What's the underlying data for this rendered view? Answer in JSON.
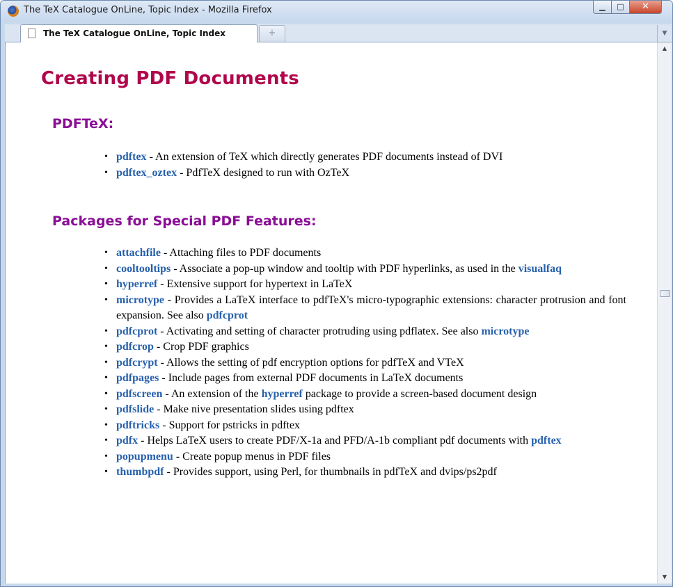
{
  "window": {
    "title": "The TeX Catalogue OnLine, Topic Index - Mozilla Firefox"
  },
  "tabs": [
    {
      "label": "The TeX Catalogue OnLine, Topic Index"
    }
  ],
  "newtab_label": "+",
  "page": {
    "title": "Creating PDF Documents",
    "sections": [
      {
        "heading": "PDFTeX:",
        "items": [
          {
            "name": "pdftex",
            "text": " - An extension of TeX which directly generates PDF documents instead of DVI"
          },
          {
            "name": "pdftex_oztex",
            "text": " - PdfTeX designed to run with OzTeX"
          }
        ]
      },
      {
        "heading": "Packages for Special PDF Features:",
        "items": [
          {
            "name": "attachfile",
            "text": " - Attaching files to PDF documents"
          },
          {
            "name": "cooltooltips",
            "text": " - Associate a pop-up window and tooltip with PDF hyperlinks, as used in the ",
            "link2": "visualfaq"
          },
          {
            "name": "hyperref",
            "text": " - Extensive support for hypertext in LaTeX"
          },
          {
            "name": "microtype",
            "text": " - Provides a LaTeX interface to pdfTeX's micro-typographic extensions: character protrusion and font expansion. See also ",
            "link2": "pdfcprot"
          },
          {
            "name": "pdfcprot",
            "text": " - Activating and setting of character protruding using pdflatex. See also ",
            "link2": "microtype"
          },
          {
            "name": "pdfcrop",
            "text": " - Crop PDF graphics"
          },
          {
            "name": "pdfcrypt",
            "text": " - Allows the setting of pdf encryption options for pdfTeX and VTeX"
          },
          {
            "name": "pdfpages",
            "text": " - Include pages from external PDF documents in LaTeX documents"
          },
          {
            "name": "pdfscreen",
            "text": " - An extension of the ",
            "link2": "hyperref",
            "text2": " package to provide a screen-based document design"
          },
          {
            "name": "pdfslide",
            "text": " - Make nive presentation slides using pdftex"
          },
          {
            "name": "pdftricks",
            "text": " - Support for pstricks in pdftex"
          },
          {
            "name": "pdfx",
            "text": " - Helps LaTeX users to create PDF/X-1a and PFD/A-1b compliant pdf documents with ",
            "link2": "pdftex"
          },
          {
            "name": "popupmenu",
            "text": " - Create popup menus in PDF files"
          },
          {
            "name": "thumbpdf",
            "text": " - Provides support, using Perl, for thumbnails in pdfTeX and dvips/ps2pdf"
          }
        ]
      }
    ]
  }
}
